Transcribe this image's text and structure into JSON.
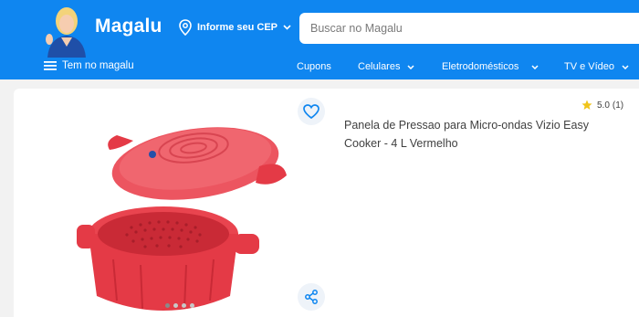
{
  "header": {
    "logo_text": "Magalu",
    "cep_label": "Informe seu CEP",
    "search_placeholder": "Buscar no Magalu",
    "brand_color": "#0f86f0"
  },
  "nav": {
    "menu_label": "Tem no magalu",
    "items": [
      {
        "label": "Cupons",
        "has_dropdown": false
      },
      {
        "label": "Celulares",
        "has_dropdown": true
      },
      {
        "label": "Eletrodomésticos",
        "has_dropdown": true
      },
      {
        "label": "TV e Vídeo",
        "has_dropdown": true
      }
    ]
  },
  "product": {
    "title": "Panela de Pressao para Micro-ondas Vizio Easy Cooker - 4 L Vermelho",
    "rating": "5.0",
    "review_count": "(1)",
    "image_icon": "red-microwave-pressure-cooker",
    "image_dots": 4,
    "active_dot": 1
  },
  "icons": {
    "favorite": "heart-icon",
    "share": "share-icon",
    "location": "location-pin-icon",
    "menu": "hamburger-icon",
    "star": "star-icon"
  },
  "colors": {
    "star": "#f0c419",
    "product_red": "#e9444f",
    "icon_blue": "#0f86f0"
  }
}
